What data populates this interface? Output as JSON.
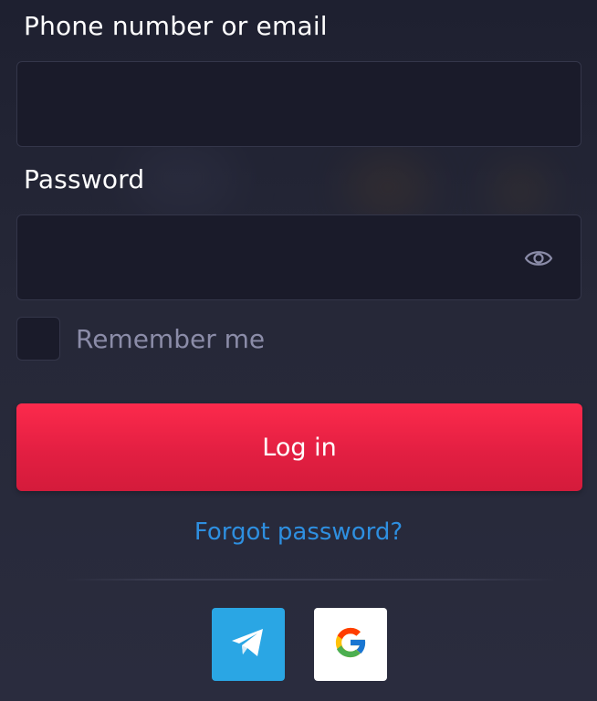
{
  "form": {
    "phone_label": "Phone number or email",
    "phone_value": "",
    "password_label": "Password",
    "password_value": "",
    "remember_label": "Remember me",
    "remember_checked": false,
    "login_label": "Log in",
    "forgot_label": "Forgot password?"
  },
  "social": {
    "telegram_icon": "telegram-icon",
    "google_icon": "google-icon"
  },
  "colors": {
    "background": "#262838",
    "field_bg": "#1a1b2a",
    "accent_red": "#e31f42",
    "link_blue": "#2e8fe0",
    "telegram_blue": "#2aa6e4"
  }
}
